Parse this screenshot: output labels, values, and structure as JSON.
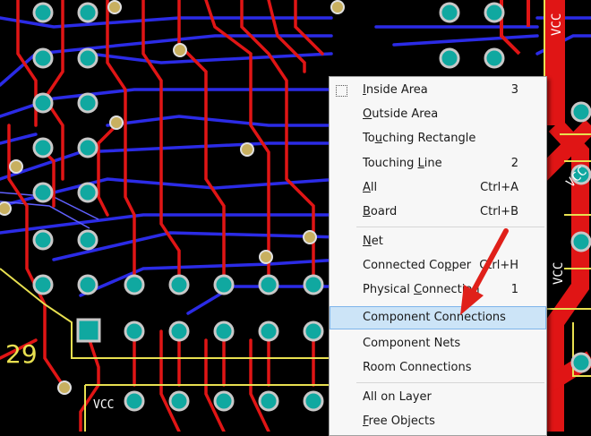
{
  "board": {
    "labels": {
      "vcc_right_1": "VCC",
      "vcc_right_2": "VCC",
      "vcc_right_3": "VCC",
      "vcc_bottom": "VCC",
      "ref_designator": "29"
    },
    "colors": {
      "background": "#000000",
      "top_trace": "#e01515",
      "bottom_trace": "#2828e0",
      "overlay": "#e8e050",
      "pad": "#10a8a0",
      "pad_ring": "#c8c8c8"
    }
  },
  "menu": {
    "items": [
      {
        "pre": "",
        "u": "I",
        "post": "nside Area",
        "shortcut": "3"
      },
      {
        "pre": "",
        "u": "O",
        "post": "utside Area",
        "shortcut": ""
      },
      {
        "pre": "To",
        "u": "u",
        "post": "ching Rectangle",
        "shortcut": ""
      },
      {
        "pre": "Touching ",
        "u": "L",
        "post": "ine",
        "shortcut": "2"
      },
      {
        "pre": "",
        "u": "A",
        "post": "ll",
        "shortcut": "Ctrl+A"
      },
      {
        "pre": "",
        "u": "B",
        "post": "oard",
        "shortcut": "Ctrl+B"
      },
      {
        "pre": "",
        "u": "N",
        "post": "et",
        "shortcut": ""
      },
      {
        "pre": "Connected Co",
        "u": "p",
        "post": "per",
        "shortcut": "Ctrl+H"
      },
      {
        "pre": "Physical ",
        "u": "C",
        "post": "onnection",
        "shortcut": "1"
      },
      {
        "pre": "Component Connections",
        "u": "",
        "post": "",
        "shortcut": ""
      },
      {
        "pre": "Component Nets",
        "u": "",
        "post": "",
        "shortcut": ""
      },
      {
        "pre": "Room Connections",
        "u": "",
        "post": "",
        "shortcut": ""
      },
      {
        "pre": "All on Layer",
        "u": "",
        "post": "",
        "shortcut": ""
      },
      {
        "pre": "",
        "u": "F",
        "post": "ree Objects",
        "shortcut": ""
      }
    ],
    "highlighted_index": 9
  },
  "annotation": {
    "arrow_color": "#e0201a"
  }
}
